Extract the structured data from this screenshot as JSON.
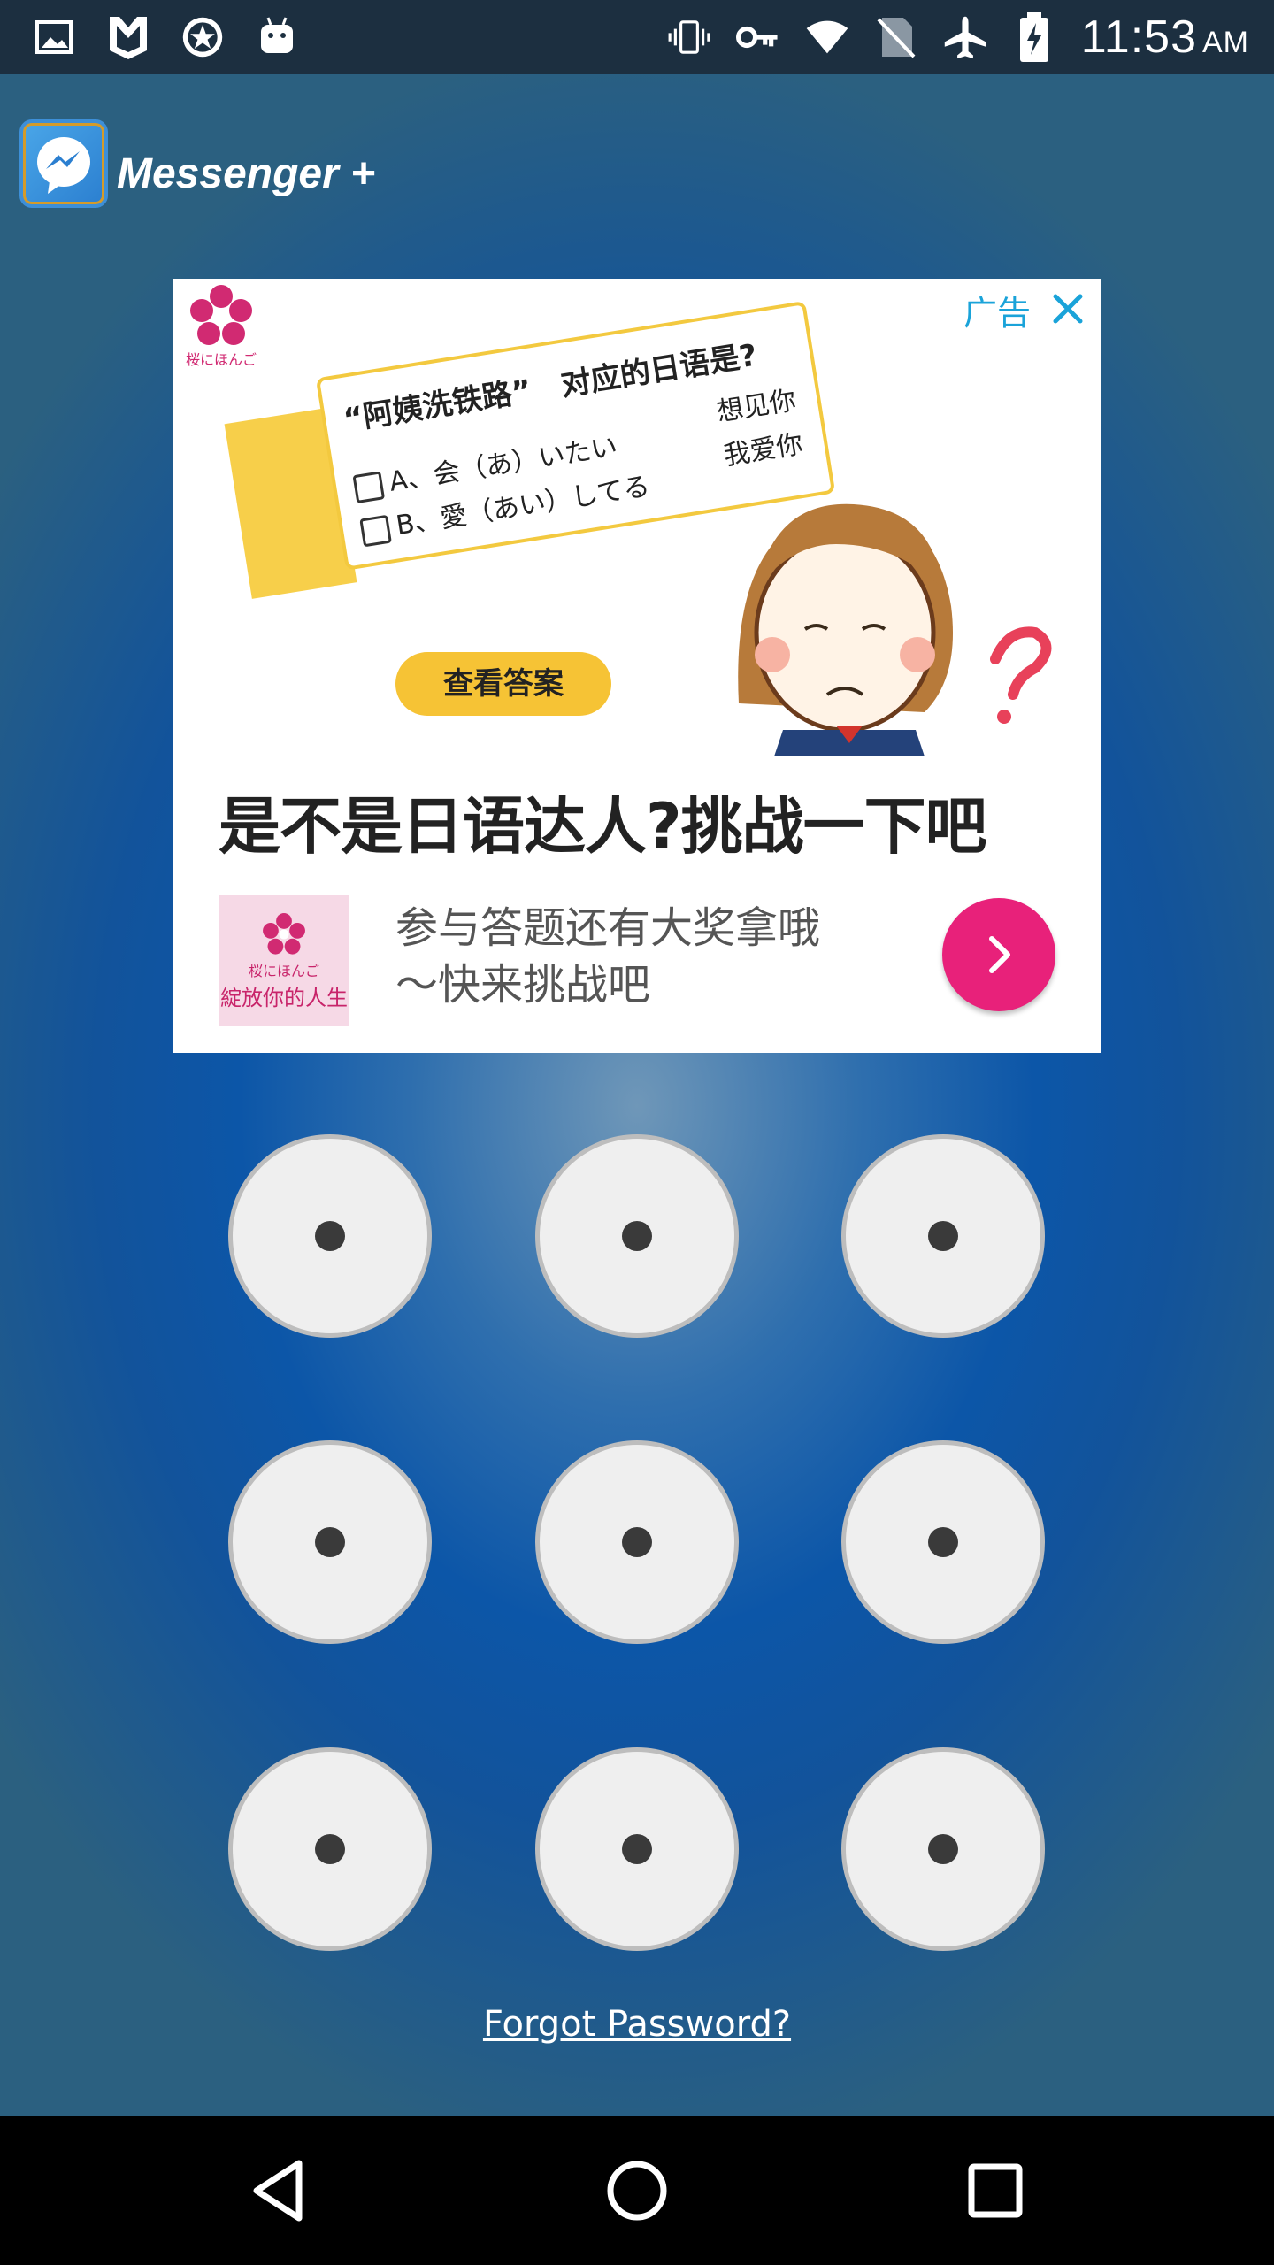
{
  "status_bar": {
    "time": "11:53",
    "ampm": "AM",
    "icons_left": [
      "image-icon",
      "shield-m-icon",
      "star-badge-icon",
      "android-icon"
    ],
    "icons_right": [
      "vibrate-icon",
      "key-icon",
      "wifi-icon",
      "no-sim-icon",
      "airplane-icon",
      "battery-charging-icon"
    ]
  },
  "app": {
    "title": "Messenger +"
  },
  "ad": {
    "tag": "广告",
    "logo_text": "桜にほんご",
    "question_title": "“阿姨洗铁路”　对应的日语是?",
    "option_a": "A、会（あ）いたい",
    "option_b": "B、愛（あい）してる",
    "note_a": "想见你",
    "note_b": "我爱你",
    "cta": "查看答案",
    "headline": "是不是日语达人?挑战一下吧",
    "thumb_text": "桜にほんご",
    "thumb_script": "綻放你的人生",
    "description_line1": "参与答题还有大奖拿哦",
    "description_line2": "～快来挑战吧"
  },
  "pattern": {
    "nodes": [
      1,
      2,
      3,
      4,
      5,
      6,
      7,
      8,
      9
    ]
  },
  "forgot_password": "Forgot Password?",
  "nav": {
    "buttons": [
      "back-icon",
      "home-icon",
      "recents-icon"
    ]
  },
  "colors": {
    "status_bar": "#1c2f40",
    "ad_accent": "#e8217a",
    "ad_cta": "#f6c335",
    "ad_tag": "#1aa3d9"
  }
}
